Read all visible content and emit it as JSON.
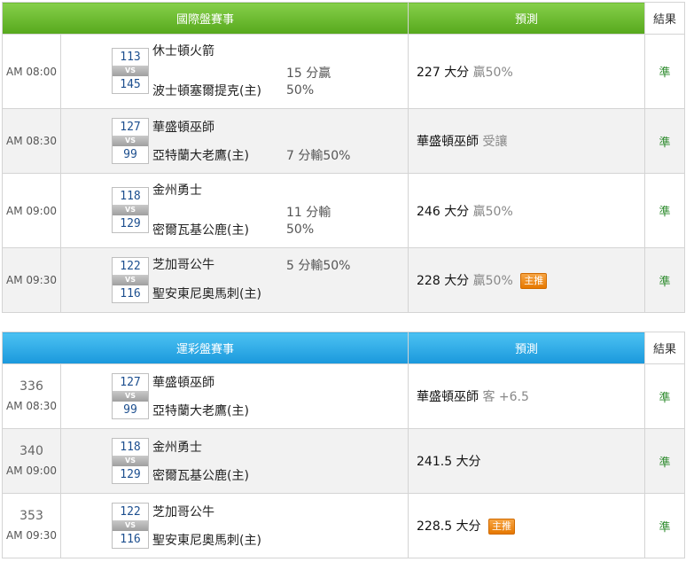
{
  "intl": {
    "header": {
      "event": "國際盤賽事",
      "predict": "預測",
      "result": "結果"
    },
    "rows": [
      {
        "time": "AM 08:00",
        "score_away": "113",
        "score_home": "145",
        "vs": "VS",
        "away": "休士頓火箭",
        "home": "波士頓塞爾提克(主)",
        "odds_line1": "15 分贏",
        "odds_line2": "50%",
        "pred_main": "227 大分",
        "pred_sub": "贏50%",
        "badge": "",
        "result": "準"
      },
      {
        "time": "AM 08:30",
        "score_away": "127",
        "score_home": "99",
        "vs": "VS",
        "away": "華盛頓巫師",
        "home": "亞特蘭大老鷹(主)",
        "odds_line1": "",
        "odds_line2": "7 分輸50%",
        "pred_main": "華盛頓巫師",
        "pred_sub": "受讓",
        "badge": "",
        "result": "準"
      },
      {
        "time": "AM 09:00",
        "score_away": "118",
        "score_home": "129",
        "vs": "VS",
        "away": "金州勇士",
        "home": "密爾瓦基公鹿(主)",
        "odds_line1": "11 分輸",
        "odds_line2": "50%",
        "pred_main": "246 大分",
        "pred_sub": "贏50%",
        "badge": "",
        "result": "準"
      },
      {
        "time": "AM 09:30",
        "score_away": "122",
        "score_home": "116",
        "vs": "VS",
        "away": "芝加哥公牛",
        "home": "聖安東尼奧馬刺(主)",
        "odds_line1": "5 分輸50%",
        "odds_line2": "",
        "pred_main": "228 大分",
        "pred_sub": "贏50%",
        "badge": "主推",
        "result": "準"
      }
    ]
  },
  "lottery": {
    "header": {
      "event": "運彩盤賽事",
      "predict": "預測",
      "result": "結果"
    },
    "rows": [
      {
        "num": "336",
        "time": "AM 08:30",
        "score_away": "127",
        "score_home": "99",
        "vs": "VS",
        "away": "華盛頓巫師",
        "home": "亞特蘭大老鷹(主)",
        "pred_main": "華盛頓巫師",
        "pred_sub": "客 +6.5",
        "badge": "",
        "result": "準"
      },
      {
        "num": "340",
        "time": "AM 09:00",
        "score_away": "118",
        "score_home": "129",
        "vs": "VS",
        "away": "金州勇士",
        "home": "密爾瓦基公鹿(主)",
        "pred_main": "241.5 大分",
        "pred_sub": "",
        "badge": "",
        "result": "準"
      },
      {
        "num": "353",
        "time": "AM 09:30",
        "score_away": "122",
        "score_home": "116",
        "vs": "VS",
        "away": "芝加哥公牛",
        "home": "聖安東尼奧馬刺(主)",
        "pred_main": "228.5 大分",
        "pred_sub": "",
        "badge": "主推",
        "result": "準"
      }
    ]
  }
}
